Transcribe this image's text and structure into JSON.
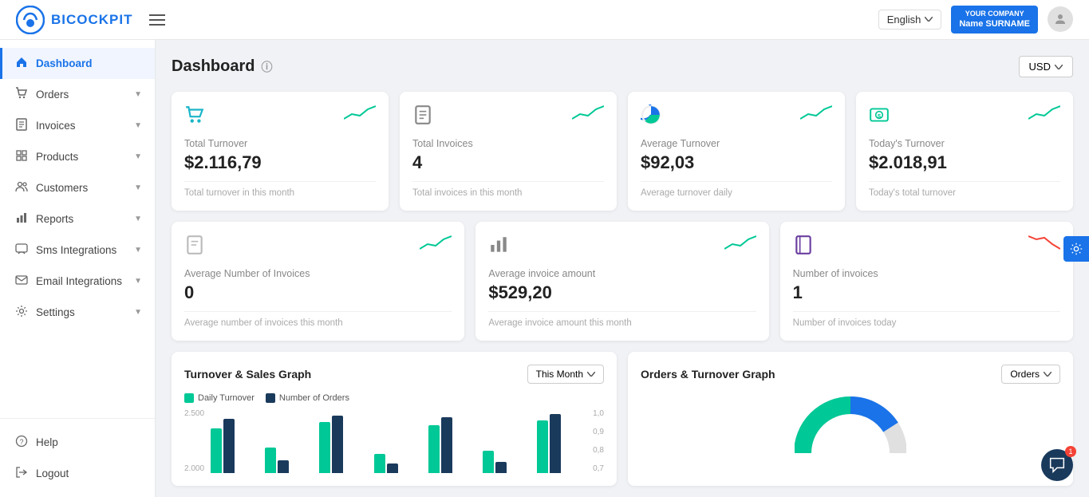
{
  "header": {
    "logo_text": "BICOCKPIT",
    "hamburger_label": "Menu",
    "language": "English",
    "user_company": "YOUR COMPANY",
    "user_name": "Name SURNAME"
  },
  "sidebar": {
    "items": [
      {
        "id": "dashboard",
        "label": "Dashboard",
        "active": true,
        "icon": "home-icon",
        "chevron": false
      },
      {
        "id": "orders",
        "label": "Orders",
        "active": false,
        "icon": "cart-icon",
        "chevron": true
      },
      {
        "id": "invoices",
        "label": "Invoices",
        "active": false,
        "icon": "invoice-icon",
        "chevron": true
      },
      {
        "id": "products",
        "label": "Products",
        "active": false,
        "icon": "product-icon",
        "chevron": true
      },
      {
        "id": "customers",
        "label": "Customers",
        "active": false,
        "icon": "customers-icon",
        "chevron": true
      },
      {
        "id": "reports",
        "label": "Reports",
        "active": false,
        "icon": "reports-icon",
        "chevron": true
      },
      {
        "id": "sms",
        "label": "Sms Integrations",
        "active": false,
        "icon": "sms-icon",
        "chevron": true
      },
      {
        "id": "email",
        "label": "Email Integrations",
        "active": false,
        "icon": "email-icon",
        "chevron": true
      },
      {
        "id": "settings",
        "label": "Settings",
        "active": false,
        "icon": "settings-icon",
        "chevron": true
      }
    ],
    "bottom": [
      {
        "id": "help",
        "label": "Help",
        "icon": "help-icon"
      },
      {
        "id": "logout",
        "label": "Logout",
        "icon": "logout-icon"
      }
    ]
  },
  "dashboard": {
    "title": "Dashboard",
    "currency_btn": "USD",
    "cards_row1": [
      {
        "id": "total-turnover",
        "label": "Total Turnover",
        "value": "$2.116,79",
        "desc": "Total turnover in this month",
        "icon": "cart-icon",
        "icon_color": "#1ab5c8",
        "trend": "up"
      },
      {
        "id": "total-invoices",
        "label": "Total Invoices",
        "value": "4",
        "desc": "Total invoices in this month",
        "icon": "doc-icon",
        "icon_color": "#888",
        "trend": "up"
      },
      {
        "id": "average-turnover",
        "label": "Average Turnover",
        "value": "$92,03",
        "desc": "Average turnover daily",
        "icon": "pie-icon",
        "icon_color": "#1a73e8",
        "trend": "up"
      },
      {
        "id": "todays-turnover",
        "label": "Today's Turnover",
        "value": "$2.018,91",
        "desc": "Today's total turnover",
        "icon": "money-icon",
        "icon_color": "#00c896",
        "trend": "up"
      }
    ],
    "cards_row2": [
      {
        "id": "avg-num-invoices",
        "label": "Average Number of Invoices",
        "value": "0",
        "desc": "Average number of invoices this month",
        "icon": "doc2-icon",
        "icon_color": "#888",
        "trend": "up"
      },
      {
        "id": "avg-invoice-amount",
        "label": "Average invoice amount",
        "value": "$529,20",
        "desc": "Average invoice amount this month",
        "icon": "barchart-icon",
        "icon_color": "#555",
        "trend": "up"
      },
      {
        "id": "num-invoices",
        "label": "Number of invoices",
        "value": "1",
        "desc": "Number of invoices today",
        "icon": "notebook-icon",
        "icon_color": "#6b3fa0",
        "trend": "down"
      }
    ],
    "turnover_graph": {
      "title": "Turnover & Sales Graph",
      "filter": "This Month",
      "legend": [
        {
          "label": "Daily Turnover",
          "color": "#00c896"
        },
        {
          "label": "Number of Orders",
          "color": "#1a3a5c"
        }
      ],
      "y_left": [
        "2.500",
        "2.000"
      ],
      "y_right": [
        "1,0",
        "0,9",
        "0,8",
        "0,7"
      ],
      "bars": [
        {
          "green": 70,
          "navy": 85
        },
        {
          "green": 40,
          "navy": 20
        },
        {
          "green": 80,
          "navy": 90
        },
        {
          "green": 30,
          "navy": 15
        },
        {
          "green": 75,
          "navy": 88
        },
        {
          "green": 35,
          "navy": 18
        },
        {
          "green": 82,
          "navy": 92
        }
      ]
    },
    "orders_graph": {
      "title": "Orders & Turnover Graph",
      "filter": "Orders"
    }
  }
}
